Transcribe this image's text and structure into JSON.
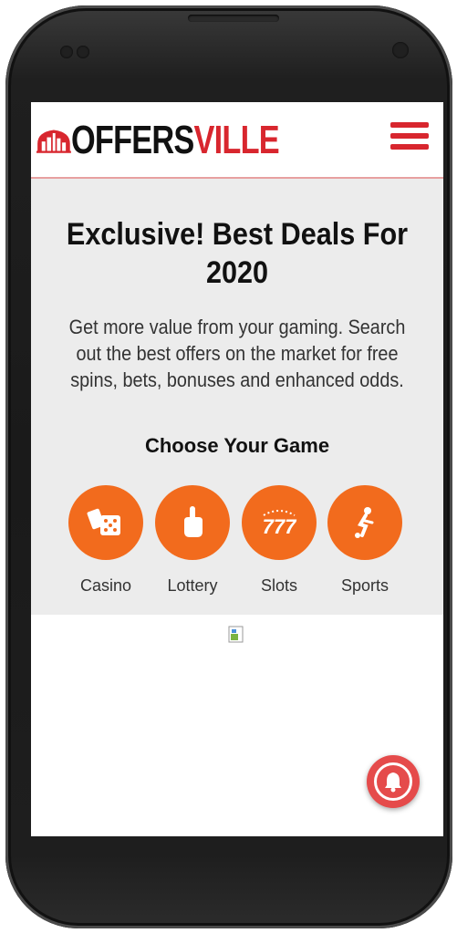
{
  "logo": {
    "text_part1": "OFFERS",
    "text_part2": "VILLE",
    "brand_color": "#d8262e"
  },
  "header": {
    "menu_icon": "hamburger-menu-icon"
  },
  "hero": {
    "title": "Exclusive! Best Deals For 2020",
    "description": "Get more value from your gaming. Search out the best offers on the market for free spins, bets, bonuses and enhanced odds.",
    "choose_heading": "Choose Your Game",
    "background": "#ececec"
  },
  "games": [
    {
      "label": "Casino",
      "icon": "casino-cards-dice-icon"
    },
    {
      "label": "Lottery",
      "icon": "lottery-hand-icon"
    },
    {
      "label": "Slots",
      "icon": "slots-777-icon"
    },
    {
      "label": "Sports",
      "icon": "sports-player-icon"
    }
  ],
  "accent_color": "#f26b1d",
  "notification_button": {
    "icon": "bell-icon",
    "color": "#e54b4b"
  }
}
